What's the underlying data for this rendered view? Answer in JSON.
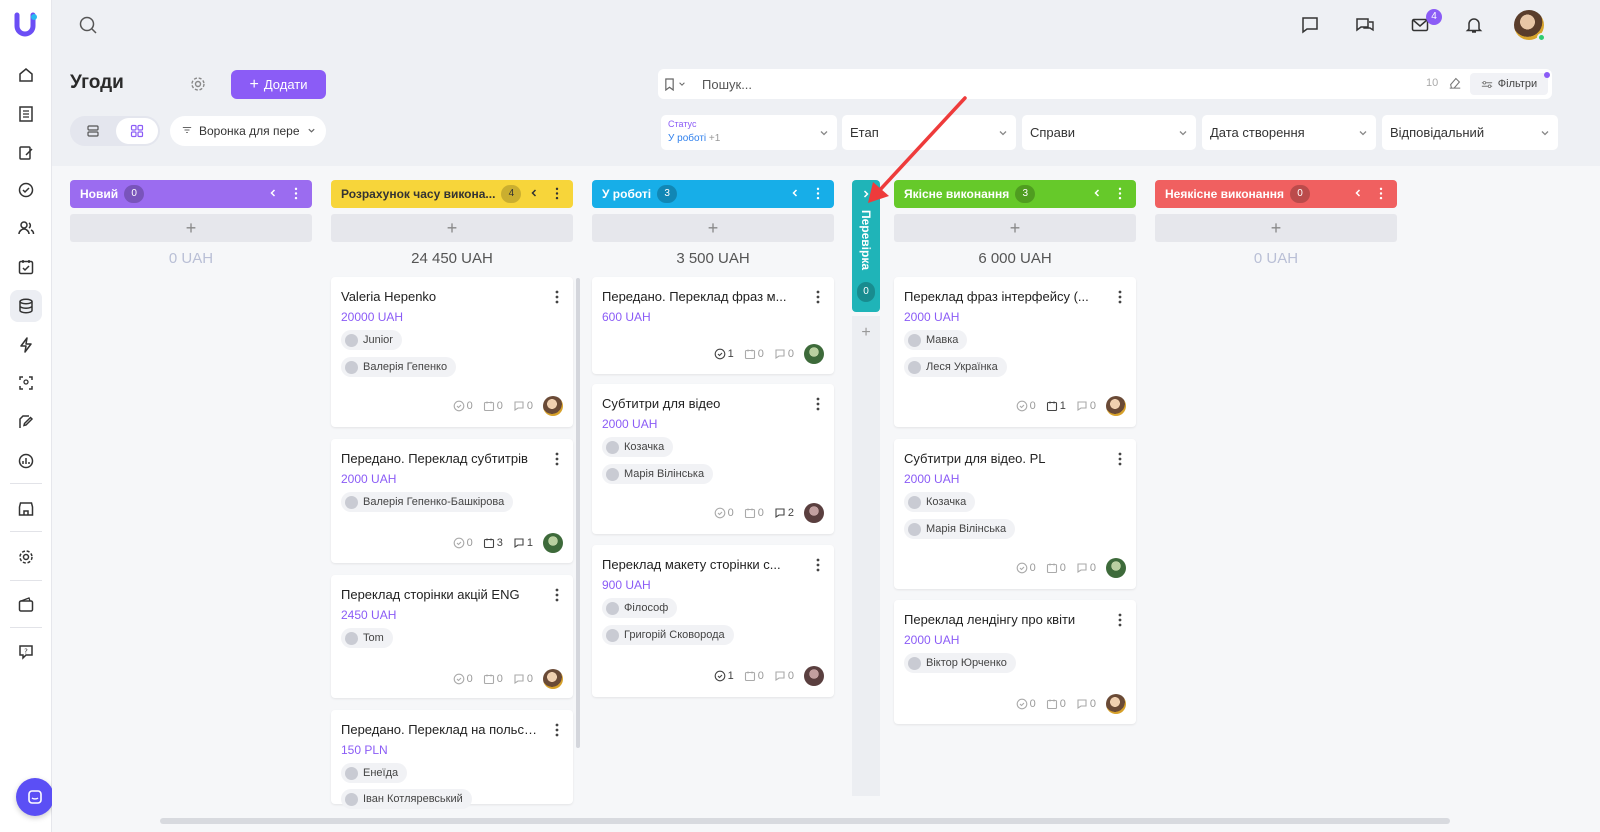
{
  "header": {
    "title": "Угоди",
    "add_label": "Додати",
    "funnel_label": "Воронка для пере",
    "search_placeholder": "Пошук...",
    "search_count": "10",
    "filters_label": "Фільтри",
    "notif_badge": "4"
  },
  "filters": {
    "status_caption": "Статус",
    "status_value": "У роботі",
    "status_extra": "+1",
    "stage": "Етап",
    "tasks": "Справи",
    "created": "Дата створення",
    "responsible": "Відповідальний"
  },
  "columns": [
    {
      "title": "Новий",
      "count": "0",
      "total": "0 UAH",
      "color": "#9b6cf0"
    },
    {
      "title": "Розрахунок часу викона...",
      "count": "4",
      "total": "24 450 UAH",
      "color": "#f7d53a"
    },
    {
      "title": "У роботі",
      "count": "3",
      "total": "3 500 UAH",
      "color": "#17aee8"
    },
    {
      "title": "Якісне виконання",
      "count": "3",
      "total": "6 000 UAH",
      "color": "#66c92a"
    },
    {
      "title": "Неякісне виконання",
      "count": "0",
      "total": "0 UAH",
      "color": "#f06060"
    }
  ],
  "collapsed": {
    "title": "Перевірка",
    "count": "0",
    "color": "#1fb4b8"
  },
  "cards": {
    "c1": [
      {
        "title": "Valeria Hepenko",
        "amount": "20000 UAH",
        "chips": [
          "Junior",
          "Валерія Гепенко"
        ],
        "f1": "0",
        "f2": "0",
        "f3": "0"
      },
      {
        "title": "Передано. Переклад субтитрів",
        "amount": "2000 UAH",
        "chips": [
          "Валерія Гепенко-Башкірова"
        ],
        "f1": "0",
        "f2": "3",
        "f3": "1"
      },
      {
        "title": "Переклад сторінки акцій ENG",
        "amount": "2450 UAH",
        "chips": [
          "Tom"
        ],
        "f1": "0",
        "f2": "0",
        "f3": "0"
      },
      {
        "title": "Передано. Переклад на польську",
        "amount": "150 PLN",
        "chips": [
          "Енеїда",
          "Іван Котляревський"
        ],
        "f1": "",
        "f2": "",
        "f3": ""
      }
    ],
    "c2": [
      {
        "title": "Передано. Переклад фраз м...",
        "amount": "600 UAH",
        "chips": [],
        "f1": "1",
        "f2": "0",
        "f3": "0"
      },
      {
        "title": "Субтитри для відео",
        "amount": "2000 UAH",
        "chips": [
          "Козачка",
          "Марія Вілінська"
        ],
        "f1": "0",
        "f2": "0",
        "f3": "2"
      },
      {
        "title": "Переклад макету сторінки с...",
        "amount": "900 UAH",
        "chips": [
          "Філософ",
          "Григорій Сковорода"
        ],
        "f1": "1",
        "f2": "0",
        "f3": "0"
      }
    ],
    "c3": [
      {
        "title": "Переклад фраз інтерфейсу (...",
        "amount": "2000 UAH",
        "chips": [
          "Мавка",
          "Леся Українка"
        ],
        "f1": "0",
        "f2": "1",
        "f3": "0"
      },
      {
        "title": "Субтитри для відео. PL",
        "amount": "2000 UAH",
        "chips": [
          "Козачка",
          "Марія Вілінська"
        ],
        "f1": "0",
        "f2": "0",
        "f3": "0"
      },
      {
        "title": "Переклад лендінгу про квіти",
        "amount": "2000 UAH",
        "chips": [
          "Віктор Юрченко"
        ],
        "f1": "0",
        "f2": "0",
        "f3": "0"
      }
    ]
  }
}
